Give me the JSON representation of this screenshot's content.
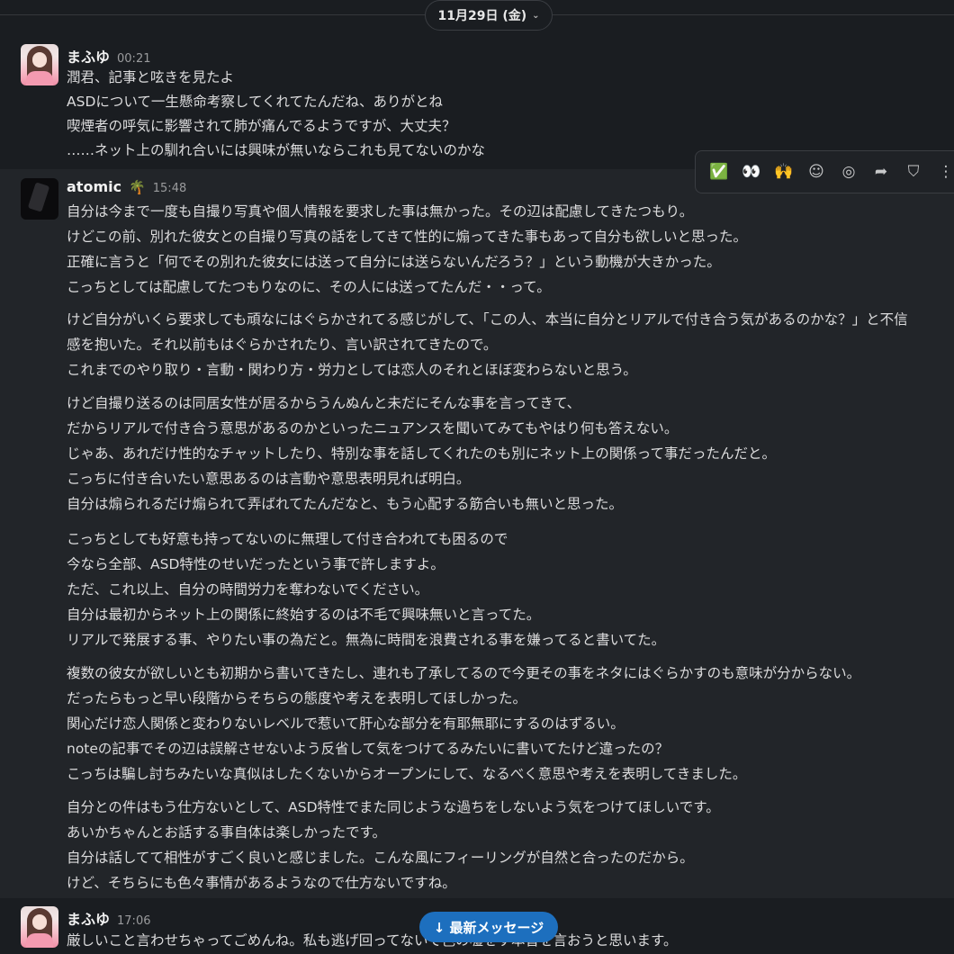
{
  "date_pill": {
    "label": "11月29日 (金)",
    "chevron": "chevron-down-icon"
  },
  "messages": [
    {
      "sender": "まふゆ",
      "time": "00:21",
      "lines": [
        "潤君、記事と呟きを見たよ",
        "ASDについて一生懸命考察してくれてたんだね、ありがとね",
        "喫煙者の呼気に影響されて肺が痛んでるようですが、大丈夫？",
        "……ネット上の馴れ合いには興味が無いならこれも見てないのかな"
      ]
    },
    {
      "sender": "atomic",
      "status_emoji": "🌴",
      "time": "15:48",
      "paragraphs": [
        [
          "自分は今まで一度も自撮り写真や個人情報を要求した事は無かった。その辺は配慮してきたつもり。",
          "けどこの前、別れた彼女との自撮り写真の話をしてきて性的に煽ってきた事もあって自分も欲しいと思った。",
          "正確に言うと「何でその別れた彼女には送って自分には送らないんだろう？」という動機が大きかった。",
          "こっちとしては配慮してたつもりなのに、その人には送ってたんだ・・って。"
        ],
        [
          "けど自分がいくら要求しても頑なにはぐらかされてる感じがして、「この人、本当に自分とリアルで付き合う気があるのかな？」と不信",
          "感を抱いた。それ以前もはぐらかされたり、言い訳されてきたので。",
          "これまでのやり取り・言動・関わり方・労力としては恋人のそれとほぼ変わらないと思う。"
        ],
        [
          "けど自撮り送るのは同居女性が居るからうんぬんと未だにそんな事を言ってきて、",
          "だからリアルで付き合う意思があるのかといったニュアンスを聞いてみてもやはり何も答えない。",
          "じゃあ、あれだけ性的なチャットしたり、特別な事を話してくれたのも別にネット上の関係って事だったんだと。",
          "こっちに付き合いたい意思あるのは言動や意思表明見れば明白。",
          "自分は煽られるだけ煽られて弄ばれてたんだなと、もう心配する筋合いも無いと思った。"
        ],
        [
          "こっちとしても好意も持ってないのに無理して付き合われても困るので",
          "今なら全部、ASD特性のせいだったという事で許しますよ。",
          "ただ、これ以上、自分の時間労力を奪わないでください。",
          "自分は最初からネット上の関係に終始するのは不毛で興味無いと言ってた。",
          "リアルで発展する事、やりたい事の為だと。無為に時間を浪費される事を嫌ってると書いてた。"
        ],
        [
          "複数の彼女が欲しいとも初期から書いてきたし、連れも了承してるので今更その事をネタにはぐらかすのも意味が分からない。",
          "だったらもっと早い段階からそちらの態度や考えを表明してほしかった。",
          "関心だけ恋人関係と変わりないレベルで惹いて肝心な部分を有耶無耶にするのはずるい。",
          "noteの記事でその辺は誤解させないよう反省して気をつけてるみたいに書いてたけど違ったの？",
          "こっちは騙し討ちみたいな真似はしたくないからオープンにして、なるべく意思や考えを表明してきました。"
        ],
        [
          "自分との件はもう仕方ないとして、ASD特性でまた同じような過ちをしないよう気をつけてほしいです。",
          "あいかちゃんとお話する事自体は楽しかったです。",
          "自分は話してて相性がすごく良いと感じました。こんな風にフィーリングが自然と合ったのだから。",
          "けど、そちらにも色々事情があるようなので仕方ないですね。"
        ]
      ]
    },
    {
      "sender": "まふゆ",
      "time": "17:06",
      "lines": [
        "厳しいこと言わせちゃってごめんね。私も逃げ回ってないで色の嘘をす本音を言おうと思います。"
      ]
    }
  ],
  "toolbar": {
    "items": [
      {
        "icon": "✅",
        "name": "check-reaction-icon"
      },
      {
        "icon": "👀",
        "name": "eyes-reaction-icon"
      },
      {
        "icon": "🙌",
        "name": "raised-hands-reaction-icon"
      },
      {
        "icon": "☺",
        "name": "add-reaction-icon"
      },
      {
        "icon": "◎",
        "name": "reply-in-thread-icon"
      },
      {
        "icon": "➦",
        "name": "forward-icon"
      },
      {
        "icon": "⛉",
        "name": "bookmark-icon"
      },
      {
        "icon": "⋮",
        "name": "more-actions-icon"
      }
    ]
  },
  "new_messages_button": {
    "label": "↓ 最新メッセージ"
  }
}
